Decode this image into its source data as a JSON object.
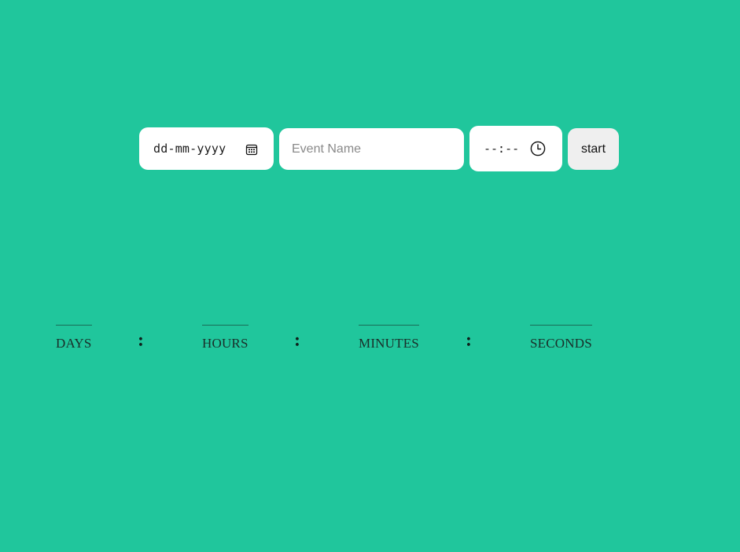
{
  "form": {
    "date_placeholder": "dd-mm-yyyy",
    "event_placeholder": "Event Name",
    "time_placeholder": "--:--",
    "start_label": "start"
  },
  "countdown": {
    "days_label": "DAYS",
    "hours_label": "HOURS",
    "minutes_label": "MINUTES",
    "seconds_label": "SECONDS",
    "separator": ":"
  },
  "colors": {
    "background": "#20c69c",
    "field": "#ffffff",
    "button": "#efefef"
  },
  "icons": {
    "date": "calendar-icon",
    "time": "clock-icon"
  }
}
